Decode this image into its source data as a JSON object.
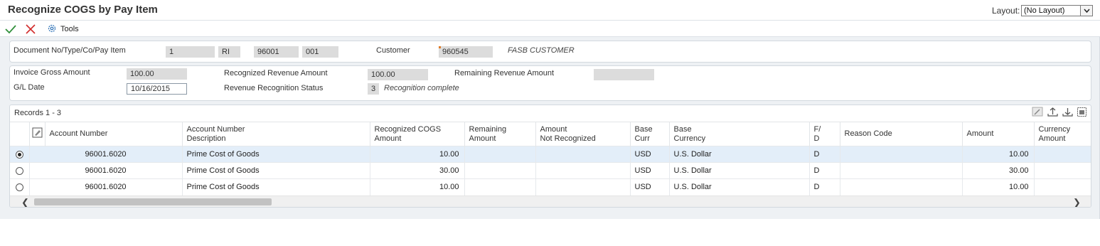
{
  "window": {
    "title": "Recognize COGS by Pay Item",
    "layout_label": "Layout:",
    "layout_value": "(No Layout)"
  },
  "toolbar": {
    "ok_icon": "checkmark-icon",
    "cancel_icon": "close-icon",
    "tools_label": "Tools"
  },
  "header": {
    "doc_label": "Document No/Type/Co/Pay Item",
    "doc_no": "1",
    "doc_type": "RI",
    "doc_co": "96001",
    "pay_item": "001",
    "customer_label": "Customer",
    "customer_no": "960545",
    "customer_name": "FASB CUSTOMER"
  },
  "summary": {
    "gross_label": "Invoice Gross Amount",
    "gross_value": "100.00",
    "recognized_label": "Recognized Revenue Amount",
    "recognized_value": "100.00",
    "remaining_label": "Remaining Revenue Amount",
    "remaining_value": "",
    "gl_date_label": "G/L Date",
    "gl_date_value": "10/16/2015",
    "status_label": "Revenue Recognition Status",
    "status_code": "3",
    "status_desc": "Recognition complete"
  },
  "grid": {
    "records_label": "Records 1 - 3",
    "columns": [
      "Account Number",
      "Account Number Description",
      "Recognized COGS Amount",
      "Remaining Amount",
      "Amount Not Recognized",
      "Base Curr",
      "Base Currency",
      "F/ D",
      "Reason Code",
      "Amount",
      "Currency Amount"
    ],
    "rows": [
      {
        "account": "96001.6020",
        "description": "Prime Cost of Goods",
        "recognized": "10.00",
        "remaining": "",
        "not_recognized": "",
        "base_curr": "USD",
        "base_currency": "U.S. Dollar",
        "fd": "D",
        "reason": "",
        "amount": "10.00",
        "currency_amount": ""
      },
      {
        "account": "96001.6020",
        "description": "Prime Cost of Goods",
        "recognized": "30.00",
        "remaining": "",
        "not_recognized": "",
        "base_curr": "USD",
        "base_currency": "U.S. Dollar",
        "fd": "D",
        "reason": "",
        "amount": "30.00",
        "currency_amount": ""
      },
      {
        "account": "96001.6020",
        "description": "Prime Cost of Goods",
        "recognized": "10.00",
        "remaining": "",
        "not_recognized": "",
        "base_curr": "USD",
        "base_currency": "U.S. Dollar",
        "fd": "D",
        "reason": "",
        "amount": "10.00",
        "currency_amount": ""
      }
    ],
    "selected_row": 0
  }
}
